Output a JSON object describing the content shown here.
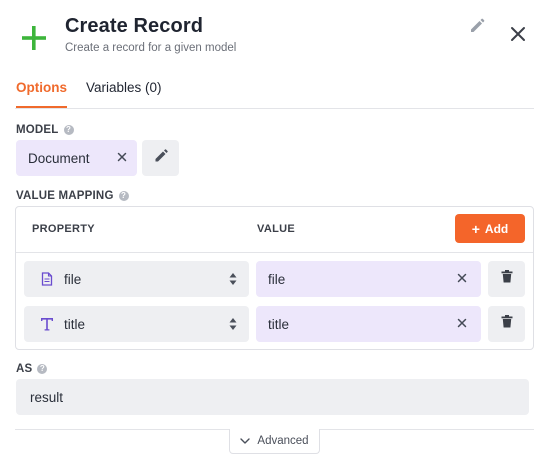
{
  "header": {
    "title": "Create Record",
    "subtitle": "Create a record for a given model"
  },
  "tabs": [
    {
      "label": "Options",
      "active": true
    },
    {
      "label": "Variables (0)",
      "active": false
    }
  ],
  "model": {
    "label": "MODEL",
    "value": "Document",
    "clear_symbol": "✕"
  },
  "value_mapping": {
    "label": "VALUE MAPPING",
    "col_property": "PROPERTY",
    "col_value": "VALUE",
    "add_label": "Add",
    "rows": [
      {
        "property": "file",
        "property_icon": "file-icon",
        "value": "file"
      },
      {
        "property": "title",
        "property_icon": "text-type-icon",
        "value": "title"
      }
    ]
  },
  "as": {
    "label": "AS",
    "value": "result"
  },
  "advanced_label": "Advanced",
  "colors": {
    "accent": "#f4652a",
    "plus_icon": "#3db53b",
    "chip_bg": "#ede7fb",
    "field_bg": "#eeeff2",
    "type_icon": "#6a4ccf"
  }
}
